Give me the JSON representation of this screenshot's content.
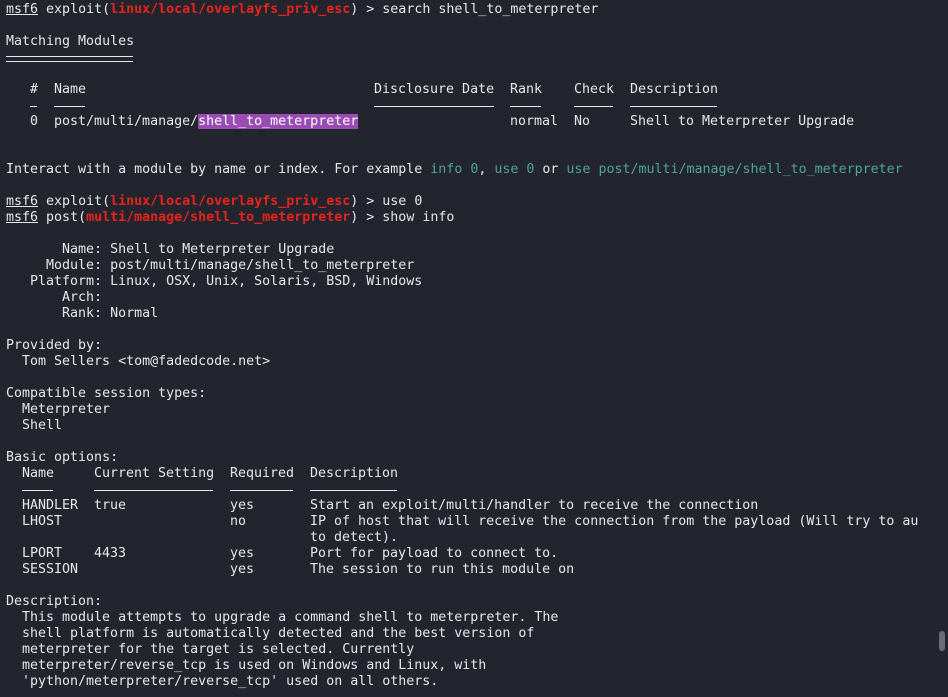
{
  "prompt_label": "msf6",
  "commands": [
    {
      "type": "exploit(",
      "module": "linux/local/overlayfs_priv_esc",
      "suffix": ") > ",
      "cmd": "search shell_to_meterpreter"
    },
    {
      "type": "exploit(",
      "module": "linux/local/overlayfs_priv_esc",
      "suffix": ") > ",
      "cmd": "use 0"
    },
    {
      "type": "post(",
      "module": "multi/manage/shell_to_meterpreter",
      "suffix": ") > ",
      "cmd": "show info"
    }
  ],
  "search": {
    "title": "Matching Modules",
    "headers": [
      "#",
      "Name",
      "Disclosure Date",
      "Rank",
      "Check",
      "Description"
    ],
    "rows": [
      {
        "index": "0",
        "name_prefix": "post/multi/manage/",
        "name_match": "shell_to_meterpreter",
        "date": "",
        "rank": "normal",
        "check": "No",
        "description": "Shell to Meterpreter Upgrade"
      }
    ]
  },
  "interact": {
    "text": "Interact with a module by name or index. For example ",
    "ex1": "info 0",
    ", ": ", ",
    "ex2": "use 0",
    "or": " or ",
    "ex3": "use post/multi/manage/shell_to_meterpreter"
  },
  "info": [
    {
      "key": "       Name: ",
      "value": "Shell to Meterpreter Upgrade"
    },
    {
      "key": "     Module: ",
      "value": "post/multi/manage/shell_to_meterpreter"
    },
    {
      "key": "   Platform: ",
      "value": "Linux, OSX, Unix, Solaris, BSD, Windows"
    },
    {
      "key": "       Arch: ",
      "value": ""
    },
    {
      "key": "       Rank: ",
      "value": "Normal"
    }
  ],
  "provided_by": {
    "label": "Provided by:",
    "author": "Tom Sellers <tom@fadedcode.net>"
  },
  "sessions": {
    "label": "Compatible session types:",
    "items": [
      "Meterpreter",
      "Shell"
    ]
  },
  "options": {
    "label": "Basic options:",
    "headers": [
      "Name",
      "Current Setting",
      "Required",
      "Description"
    ],
    "rows": [
      {
        "name": "HANDLER",
        "setting": "true",
        "required": "yes",
        "description": "Start an exploit/multi/handler to receive the connection"
      },
      {
        "name": "LHOST",
        "setting": "",
        "required": "no",
        "description": "IP of host that will receive the connection from the payload (Will try to au",
        "description2": "to detect)."
      },
      {
        "name": "LPORT",
        "setting": "4433",
        "required": "yes",
        "description": "Port for payload to connect to."
      },
      {
        "name": "SESSION",
        "setting": "",
        "required": "yes",
        "description": "The session to run this module on"
      }
    ]
  },
  "description": {
    "label": "Description:",
    "lines": [
      "This module attempts to upgrade a command shell to meterpreter. The",
      "shell platform is automatically detected and the best version of",
      "meterpreter for the target is selected. Currently",
      "meterpreter/reverse_tcp is used on Windows and Linux, with",
      "'python/meterpreter/reverse_tcp' used on all others."
    ]
  },
  "colors": {
    "background": "#23252e",
    "module_red": "#e8221c",
    "hint_teal": "#4ea68f",
    "match_highlight": "#9a4cb4"
  }
}
